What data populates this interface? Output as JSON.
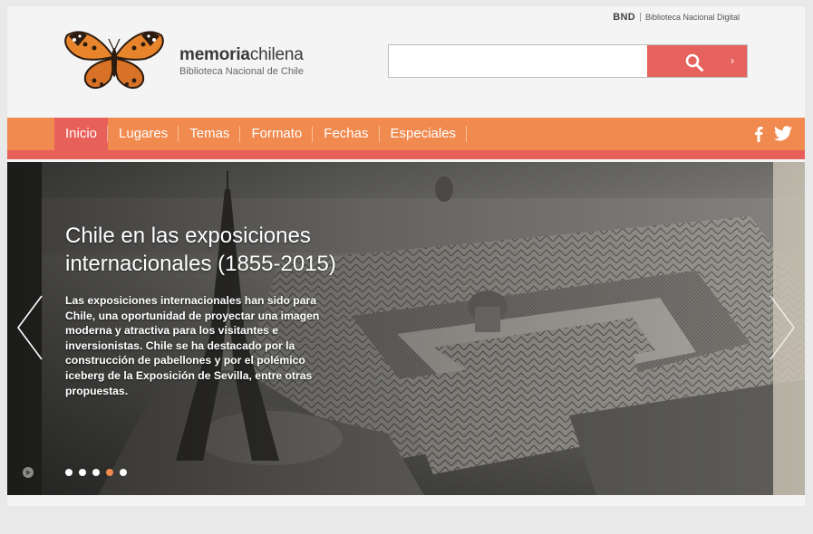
{
  "header": {
    "bnd": "BND",
    "bnd_subtitle": "Biblioteca Nacional Digital",
    "logo_bold": "memoria",
    "logo_rest": "chilena",
    "logo_sub": "Biblioteca Nacional de Chile",
    "logo_icon": "butterfly-icon"
  },
  "search": {
    "placeholder": "",
    "value": "",
    "icon": "search-icon",
    "arrow_icon": "chevron-right-icon"
  },
  "nav": {
    "items": [
      {
        "label": "Inicio",
        "active": true
      },
      {
        "label": "Lugares"
      },
      {
        "label": "Temas"
      },
      {
        "label": "Formato"
      },
      {
        "label": "Fechas"
      },
      {
        "label": "Especiales"
      }
    ],
    "social": [
      "facebook-icon",
      "twitter-icon"
    ]
  },
  "hero": {
    "title": "Chile en las exposiciones internacionales (1855-2015)",
    "body": "Las exposiciones internacionales han sido para Chile, una oportunidad de proyectar una imagen moderna y atractiva para los visitantes e inversionistas. Chile se ha destacado por la construcción de pabellones y por el polémico iceberg de la Exposición de Sevilla, entre otras propuestas.",
    "slides_total": 5,
    "active_slide": 4
  },
  "colors": {
    "nav": "#f08a4f",
    "accent": "#e8605a",
    "search_button": "#e5635c"
  }
}
